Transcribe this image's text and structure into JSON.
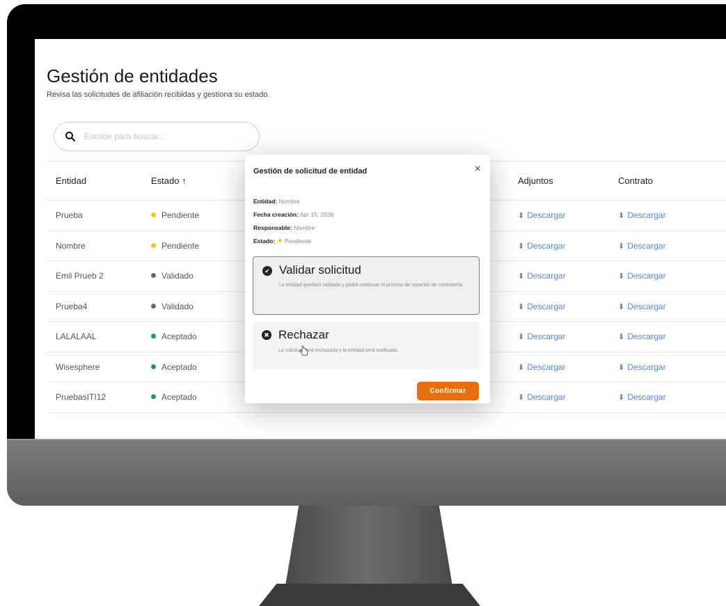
{
  "page": {
    "title": "Gestión de entidades",
    "subtitle": "Revisa las solicitudes de afiliación recibidas y gestiona su estado."
  },
  "search": {
    "placeholder": "Escribe para buscar..."
  },
  "table": {
    "headers": {
      "entidad": "Entidad",
      "estado": "Estado ↑",
      "adjuntos": "Adjuntos",
      "contrato": "Contrato"
    },
    "download_label": "Descargar",
    "rows": [
      {
        "entidad": "Prueba",
        "estado": "Pendiente",
        "status_color": "#f5c518"
      },
      {
        "entidad": "Nombre",
        "estado": "Pendiente",
        "status_color": "#f5c518"
      },
      {
        "entidad": "Emil Prueb 2",
        "estado": "Validado",
        "status_color": "#6b6b6b"
      },
      {
        "entidad": "Prueba4",
        "estado": "Validado",
        "status_color": "#6b6b6b"
      },
      {
        "entidad": "LALALAAL",
        "estado": "Aceptado",
        "status_color": "#16a34a"
      },
      {
        "entidad": "Wisesphere",
        "estado": "Aceptado",
        "status_color": "#16a34a"
      },
      {
        "entidad": "PruebasITI12",
        "estado": "Aceptado",
        "status_color": "#16a34a"
      }
    ]
  },
  "modal": {
    "title": "Gestión de solicitud de entidad",
    "close": "×",
    "fields": [
      {
        "label": "Entidad:",
        "value": "Nombre"
      },
      {
        "label": "Fecha creación:",
        "value": "Apr 15, 2026"
      },
      {
        "label": "Responsable:",
        "value": "Nombre"
      },
      {
        "label": "Estado:",
        "value": "Pendiente"
      }
    ],
    "estado_color": "#f5c518",
    "options": {
      "validar": {
        "label": "Validar solicitud",
        "description": "La entidad quedará validada y podrá continuar el proceso de creación de contraseña."
      },
      "rechazar": {
        "label": "Rechazar",
        "description": "La solicitud será rechazada y la entidad será notificada."
      }
    },
    "confirm_label": "Confirmar"
  },
  "colors": {
    "accent": "#e8700a",
    "link": "#5a84d6"
  },
  "icons": {
    "search": "search-icon",
    "download": "download-icon",
    "check": "check-circle-icon",
    "x": "x-circle-icon",
    "close": "close-icon"
  }
}
